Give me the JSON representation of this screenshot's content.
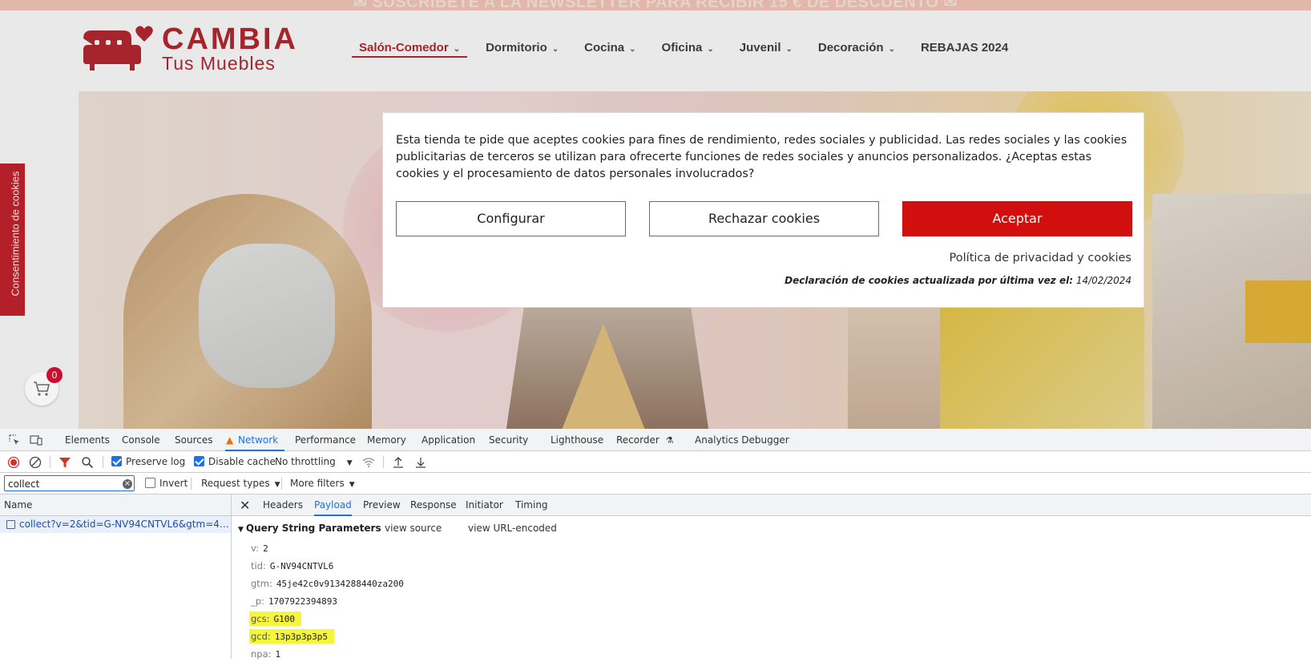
{
  "site": {
    "newsletter": "✉ SUSCRÍBETE A LA NEWSLETTER PARA RECIBIR 15 € DE DESCUENTO ✉",
    "logo": {
      "line1": "CAMBIA",
      "line2": "Tus Muebles"
    },
    "nav": [
      {
        "label": "Salón-Comedor",
        "chevron": true,
        "active": true
      },
      {
        "label": "Dormitorio",
        "chevron": true
      },
      {
        "label": "Cocina",
        "chevron": true
      },
      {
        "label": "Oficina",
        "chevron": true
      },
      {
        "label": "Juvenil",
        "chevron": true
      },
      {
        "label": "Decoración",
        "chevron": true
      },
      {
        "label": "REBAJAS 2024",
        "chevron": false
      }
    ],
    "side_tab": "Consentimiento de cookies",
    "cart_count": "0",
    "brand_color": "#b3202a"
  },
  "cookie": {
    "text": "Esta tienda te pide que aceptes cookies para fines de rendimiento, redes sociales y publicidad. Las redes sociales y las cookies publicitarias de terceros se utilizan para ofrecerte funciones de redes sociales y anuncios personalizados. ¿Aceptas estas cookies y el procesamiento de datos personales involucrados?",
    "configure": "Configurar",
    "reject": "Rechazar cookies",
    "accept": "Aceptar",
    "policy": "Política de privacidad y cookies",
    "declaration_label": "Declaración de cookies actualizada por última vez el:",
    "declaration_date": "14/02/2024",
    "accept_color": "#d10f0f"
  },
  "devtools": {
    "tabs": [
      "Elements",
      "Console",
      "Sources",
      "Network",
      "Performance",
      "Memory",
      "Application",
      "Security",
      "Lighthouse",
      "Recorder",
      "Analytics Debugger"
    ],
    "active_tab": "Network",
    "toolbar": {
      "preserve_log": "Preserve log",
      "disable_cache": "Disable cache",
      "throttling": "No throttling"
    },
    "filter": {
      "value": "collect",
      "invert": "Invert",
      "request_types": "Request types",
      "more_filters": "More filters"
    },
    "name_header": "Name",
    "request_name": "collect?v=2&tid=G-NV94CNTVL6&gtm=45je42...",
    "detail_tabs": [
      "Headers",
      "Payload",
      "Preview",
      "Response",
      "Initiator",
      "Timing"
    ],
    "active_detail_tab": "Payload",
    "payload": {
      "section_title": "Query String Parameters",
      "view_source": "view source",
      "view_url_encoded": "view URL-encoded",
      "params": [
        {
          "key": "v:",
          "value": "2",
          "highlight": false
        },
        {
          "key": "tid:",
          "value": "G-NV94CNTVL6",
          "highlight": false
        },
        {
          "key": "gtm:",
          "value": "45je42c0v9134288440za200",
          "highlight": false
        },
        {
          "key": "_p:",
          "value": "1707922394893",
          "highlight": false
        },
        {
          "key": "gcs:",
          "value": "G100",
          "highlight": true
        },
        {
          "key": "gcd:",
          "value": "13p3p3p3p5",
          "highlight": true
        },
        {
          "key": "npa:",
          "value": "1",
          "highlight": false
        }
      ]
    },
    "accent_color": "#1a73e8",
    "highlight_color": "#f5f53c"
  }
}
